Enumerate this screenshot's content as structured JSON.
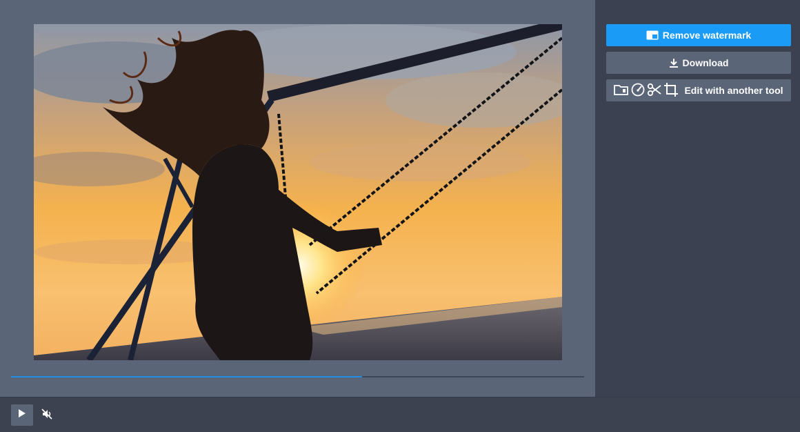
{
  "sidebar": {
    "remove_watermark_label": "Remove watermark",
    "download_label": "Download",
    "edit_tool_label": "Edit with another tool",
    "edit_tool_icons": [
      "folder-icon",
      "speedometer-icon",
      "scissors-icon",
      "crop-icon"
    ]
  },
  "player": {
    "progress": 0.612,
    "muted": true,
    "state": "paused"
  },
  "colors": {
    "accent": "#1a9bf5",
    "progress": "#1f8fe6",
    "panel": "#3b4150",
    "preview_bg": "#5a6578"
  },
  "media": {
    "description_icon": "sunset-swing-image"
  }
}
